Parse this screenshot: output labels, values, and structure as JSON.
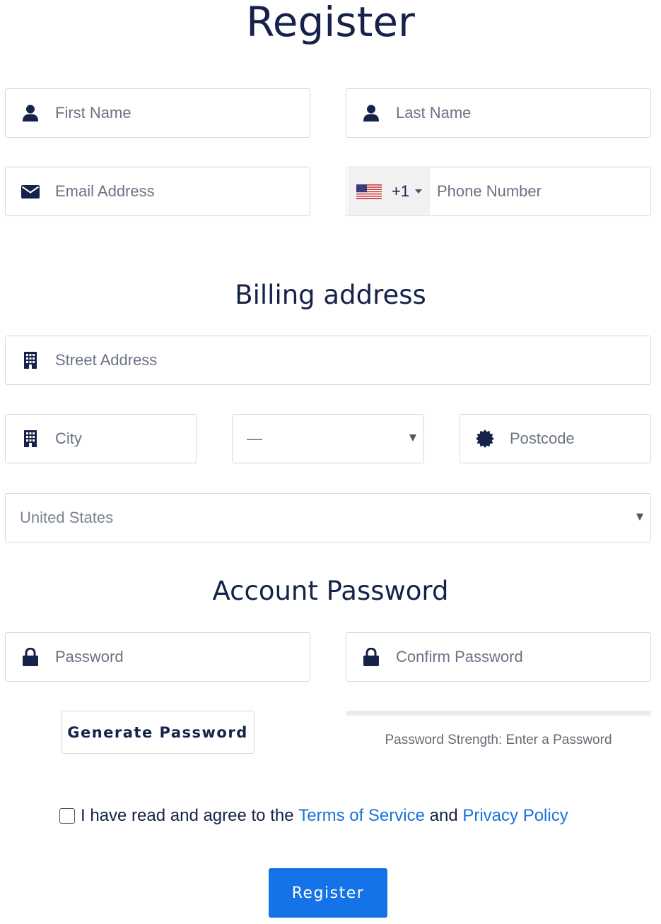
{
  "header": {
    "title": "Register"
  },
  "personal": {
    "first_name": {
      "placeholder": "First Name",
      "icon": "user-icon"
    },
    "last_name": {
      "placeholder": "Last Name",
      "icon": "user-icon"
    },
    "email": {
      "placeholder": "Email Address",
      "icon": "envelope-icon"
    },
    "phone": {
      "country_flag": "us-flag-icon",
      "dial_code": "+1",
      "placeholder": "Phone Number"
    }
  },
  "billing": {
    "title": "Billing address",
    "street": {
      "placeholder": "Street Address",
      "icon": "building-icon"
    },
    "city": {
      "placeholder": "City",
      "icon": "building-icon"
    },
    "state": {
      "selected": "—"
    },
    "postcode": {
      "placeholder": "Postcode",
      "icon": "certificate-icon"
    },
    "country": {
      "selected": "United States"
    }
  },
  "account": {
    "title": "Account Password",
    "password": {
      "placeholder": "Password",
      "icon": "lock-icon"
    },
    "confirm_password": {
      "placeholder": "Confirm Password",
      "icon": "lock-icon"
    },
    "generate_label": "Generate Password",
    "strength_text": "Password Strength: Enter a Password",
    "strength_level": 0
  },
  "agreement": {
    "prefix": "I have read and agree to the",
    "tos_link": "Terms of Service",
    "conjunction": "and",
    "privacy_link": "Privacy Policy",
    "checked": false
  },
  "submit": {
    "label": "Register"
  },
  "colors": {
    "primary": "#1473e6",
    "link": "#1a73d8",
    "text_dark": "#16224a",
    "placeholder": "#6b7384",
    "border": "#d5d8de"
  }
}
